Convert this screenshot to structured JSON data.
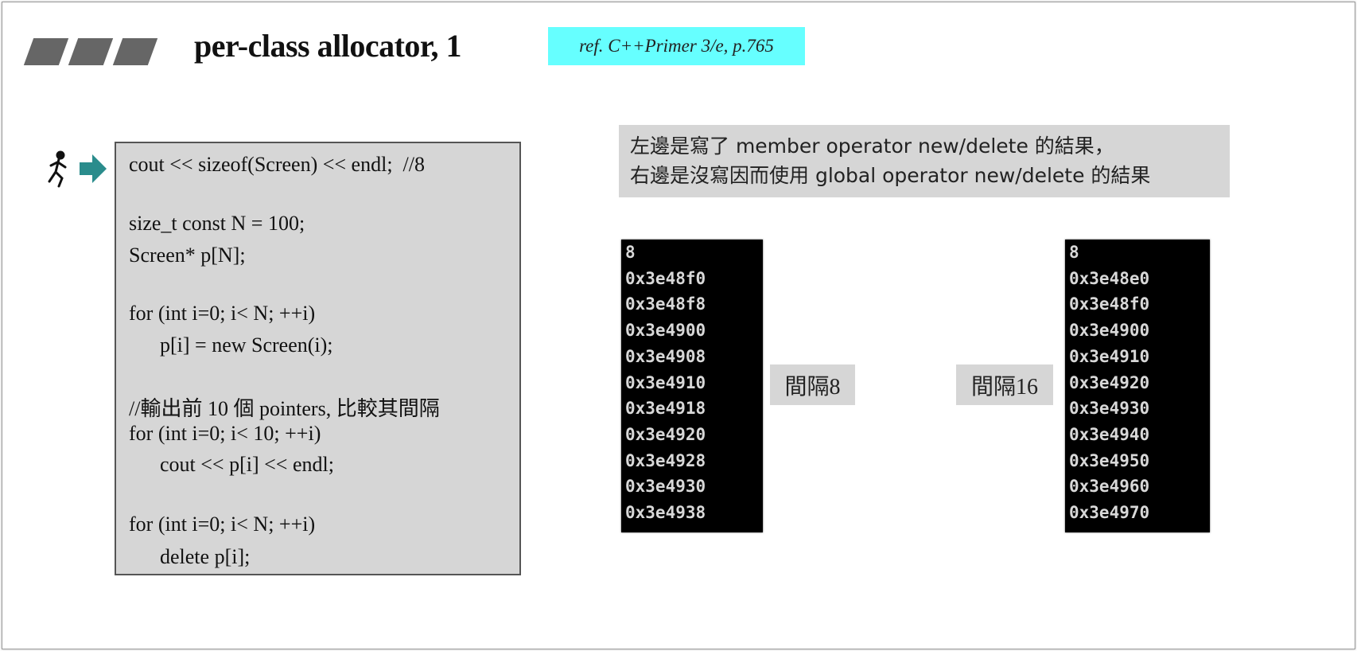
{
  "header": {
    "title": "per-class allocator, 1",
    "reference": "ref. C++Primer 3/e, p.765"
  },
  "code_lines": [
    "cout << sizeof(Screen) << endl;  //8",
    "size_t const N = 100;",
    "Screen* p[N];",
    "for (int i=0; i< N; ++i)",
    "      p[i] = new Screen(i);",
    "//輸出前 10 個 pointers, 比較其間隔",
    "for (int i=0; i< 10; ++i)",
    "      cout << p[i] << endl;",
    "for (int i=0; i< N; ++i)",
    "      delete p[i];"
  ],
  "note": {
    "line1": "左邊是寫了 member operator new/delete 的結果，",
    "line2": "右邊是沒寫因而使用 global operator new/delete 的結果"
  },
  "left_output": [
    "8",
    "0x3e48f0",
    "0x3e48f8",
    "0x3e4900",
    "0x3e4908",
    "0x3e4910",
    "0x3e4918",
    "0x3e4920",
    "0x3e4928",
    "0x3e4930",
    "0x3e4938"
  ],
  "right_output": [
    "8",
    "0x3e48e0",
    "0x3e48f0",
    "0x3e4900",
    "0x3e4910",
    "0x3e4920",
    "0x3e4930",
    "0x3e4940",
    "0x3e4950",
    "0x3e4960",
    "0x3e4970"
  ],
  "left_gap_label": "間隔8",
  "right_gap_label": "間隔16",
  "colors": {
    "ref_bg": "#66ffff",
    "arrow": "#2a8c8c",
    "box_bg": "#d6d6d6"
  }
}
